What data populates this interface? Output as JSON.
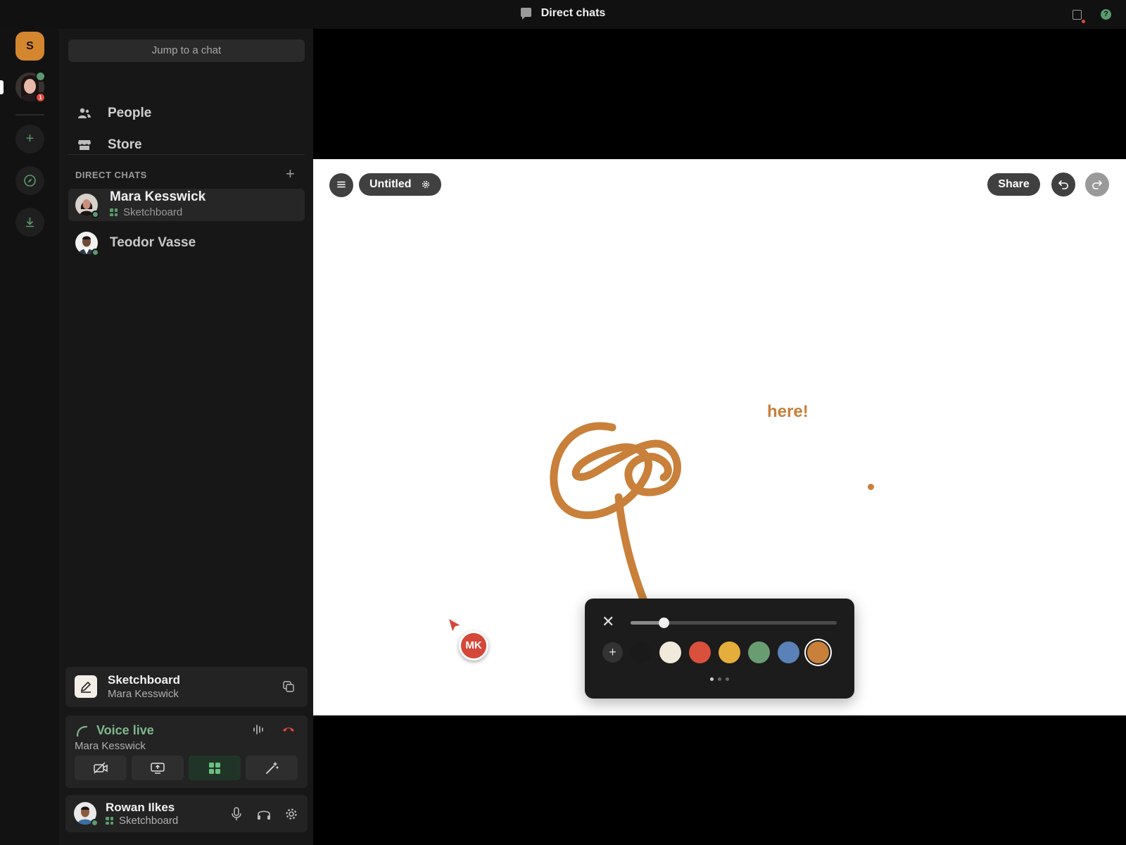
{
  "topbar": {
    "title": "Direct chats",
    "chat_icon": "chat-bubble-icon",
    "inbox_icon": "inbox-icon",
    "help_icon": "help-icon",
    "help_glyph": "?"
  },
  "rail": {
    "server_initial": "S",
    "server_color": "#d4862f",
    "dm_badge_count": "1",
    "add_server_glyph": "+"
  },
  "sidebar": {
    "jump_placeholder": "Jump to a chat",
    "nav": [
      {
        "label": "People",
        "icon": "people-icon"
      },
      {
        "label": "Store",
        "icon": "store-icon"
      }
    ],
    "dm_header": "DIRECT CHATS",
    "dm_add_glyph": "+",
    "dms": [
      {
        "name": "Mara Kesswick",
        "activity": "Sketchboard",
        "online": true,
        "active": true
      },
      {
        "name": "Teodor Vasse",
        "activity": "",
        "online": true,
        "active": false
      }
    ]
  },
  "activity_card": {
    "title": "Sketchboard",
    "subtitle": "Mara Kesswick"
  },
  "voice_card": {
    "status": "Voice live",
    "with": "Mara Kesswick",
    "accent": "#7fb78e"
  },
  "user_card": {
    "name": "Rowan Ilkes",
    "activity": "Sketchboard"
  },
  "board": {
    "title": "Untitled",
    "share_label": "Share",
    "text_note": "here!",
    "ink_color": "#c8803a",
    "remote_cursor_initials": "MK",
    "remote_cursor_color": "#d4483a",
    "palette": {
      "close_glyph": "✕",
      "add_glyph": "+",
      "stroke_size": 0.16,
      "colors": [
        "#1a1a1a",
        "#f1eadb",
        "#d9503d",
        "#e5ad3b",
        "#6a9c72",
        "#5a82b8",
        "#c8803a"
      ],
      "selected_index": 6,
      "pages": 3,
      "current_page": 0
    }
  }
}
